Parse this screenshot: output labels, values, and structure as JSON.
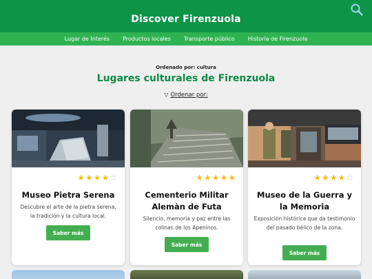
{
  "header": {
    "title": "Discover Firenzuola",
    "search_icon": "search-icon"
  },
  "nav": [
    {
      "label": "Lugar de Interés"
    },
    {
      "label": "Productos locales"
    },
    {
      "label": "Transporte público"
    },
    {
      "label": "Historia de Firenzuola"
    }
  ],
  "main": {
    "sort_label": "Ordenado por: cultura",
    "title": "Lugares culturales de Firenzuola",
    "sort_toggle": "Ordenar por:",
    "toggle_icon": "triangle-down-icon"
  },
  "cards": [
    {
      "title": "Museo Pietra Serena",
      "rating": 4,
      "description": "Descubre el arte de la pietra serena, la tradición y la cultura local.",
      "button": "Saber más"
    },
    {
      "title": "Cementerio Militar Alemàn de Futa",
      "rating": 5,
      "description": "Silencio, memoria y paz entre las colinas de los Apeninos.",
      "button": "Saber más"
    },
    {
      "title": "Museo de la Guerra y la Memoria",
      "rating": 4,
      "description": "Exposición histórica que da testimonio del pasado bélico de la zona.",
      "button": "Saber más"
    }
  ],
  "colors": {
    "header": "#0e9447",
    "navbar": "#2fb352",
    "title": "#0e8a43",
    "button": "#45ad51",
    "star": "#f2c01e"
  }
}
